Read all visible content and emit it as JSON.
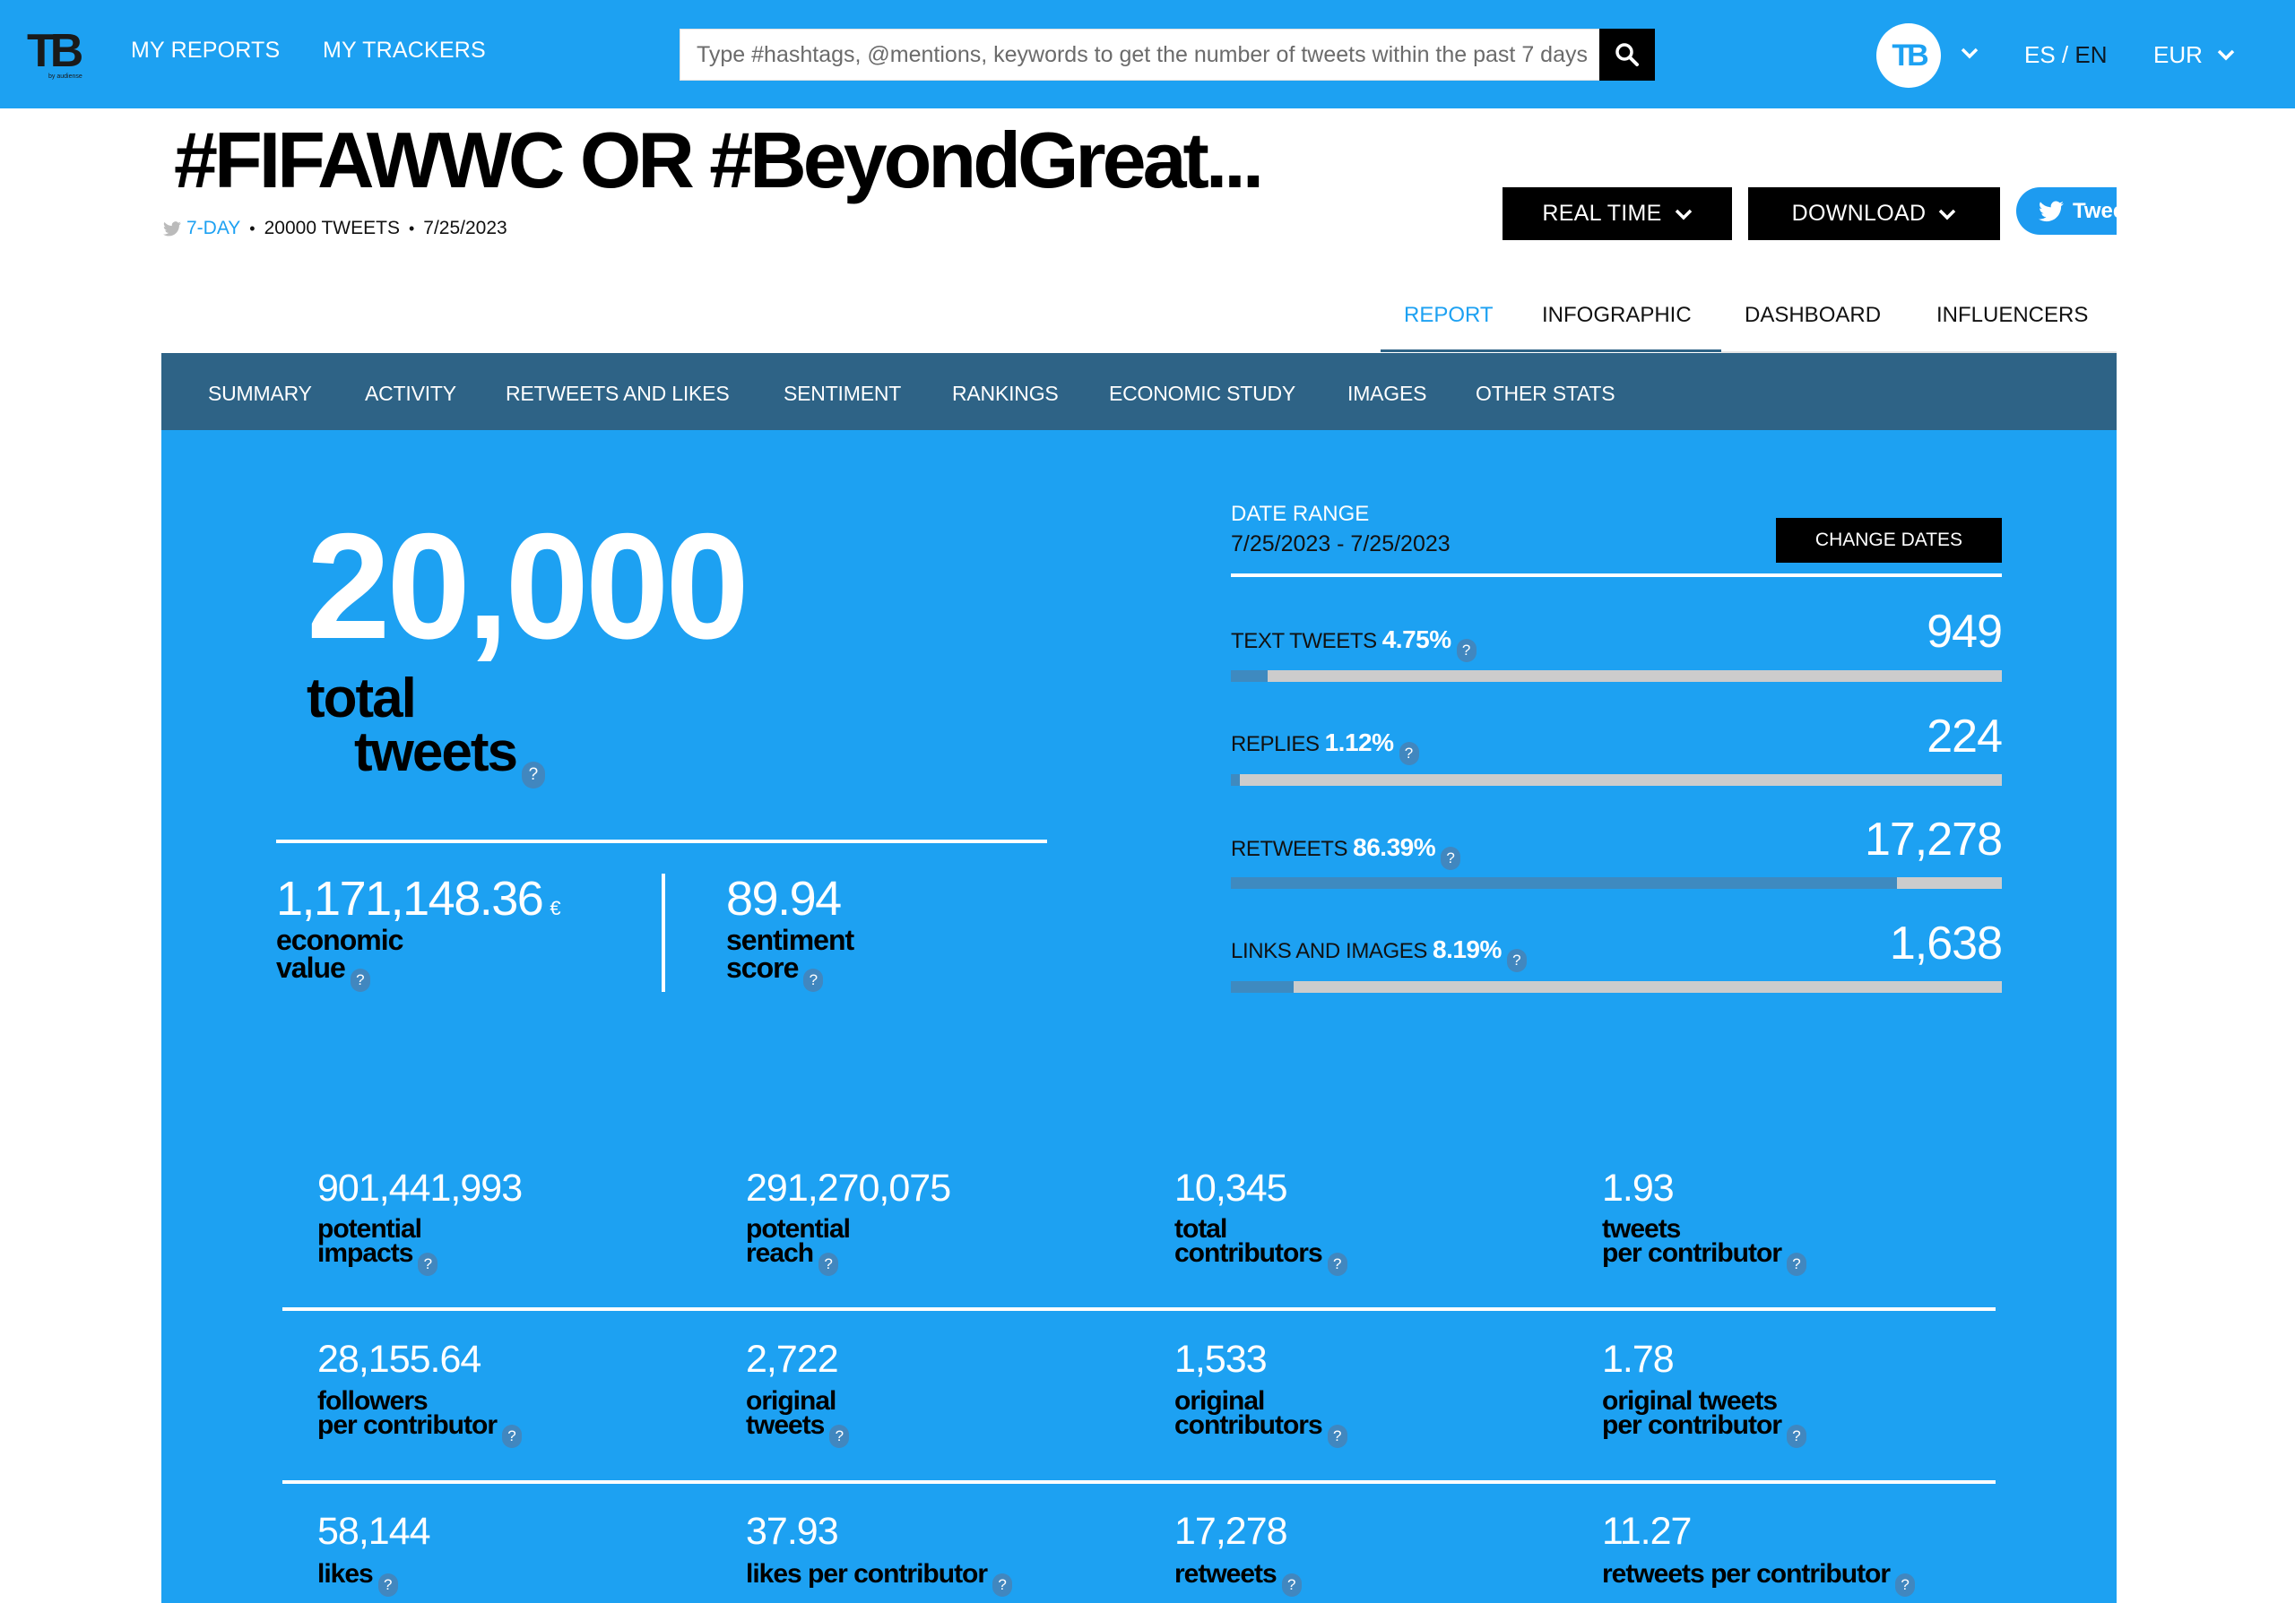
{
  "header": {
    "logo_text": "TB",
    "logo_sub": "by audiense",
    "nav": [
      "MY REPORTS",
      "MY TRACKERS"
    ],
    "search": {
      "placeholder": "Type #hashtags, @mentions, keywords to get the number of tweets within the past 7 days",
      "value": ""
    },
    "avatar_text": "TB",
    "lang": {
      "es": "ES",
      "separator": " / ",
      "en": "EN",
      "active": "EN"
    },
    "currency": "EUR"
  },
  "report": {
    "title": "#FIFAWWC OR #BeyondGreat...",
    "period": "7-DAY",
    "tweet_count_label": "20000 TWEETS",
    "date": "7/25/2023",
    "buttons": {
      "real_time": "REAL TIME",
      "download": "DOWNLOAD",
      "tweet": "Tweet"
    }
  },
  "report_tabs": [
    {
      "label": "REPORT",
      "active": true
    },
    {
      "label": "INFOGRAPHIC",
      "active": false
    },
    {
      "label": "DASHBOARD",
      "active": false
    },
    {
      "label": "INFLUENCERS",
      "active": false
    }
  ],
  "section_nav": [
    "SUMMARY",
    "ACTIVITY",
    "RETWEETS AND LIKES",
    "SENTIMENT",
    "RANKINGS",
    "ECONOMIC STUDY",
    "IMAGES",
    "OTHER STATS"
  ],
  "summary": {
    "total_tweets": "20,000",
    "total_label_1": "total",
    "total_label_2": "tweets",
    "economic_value": "1,171,148.36",
    "economic_currency": "€",
    "economic_label_1": "economic",
    "economic_label_2": "value",
    "sentiment_score": "89.94",
    "sentiment_label_1": "sentiment",
    "sentiment_label_2": "score",
    "help_glyph": "?"
  },
  "date_range": {
    "label": "DATE RANGE",
    "value": "7/25/2023 - 7/25/2023",
    "change_button": "CHANGE DATES"
  },
  "breakdown": [
    {
      "label": "TEXT TWEETS",
      "percent": "4.75%",
      "fraction": 0.0475,
      "count": "949"
    },
    {
      "label": "REPLIES",
      "percent": "1.12%",
      "fraction": 0.0112,
      "count": "224"
    },
    {
      "label": "RETWEETS",
      "percent": "86.39%",
      "fraction": 0.8639,
      "count": "17,278"
    },
    {
      "label": "LINKS AND IMAGES",
      "percent": "8.19%",
      "fraction": 0.0819,
      "count": "1,638"
    }
  ],
  "stats_grid": [
    [
      {
        "value": "901,441,993",
        "label_1": "potential",
        "label_2": "impacts"
      },
      {
        "value": "291,270,075",
        "label_1": "potential",
        "label_2": "reach"
      },
      {
        "value": "10,345",
        "label_1": "total",
        "label_2": "contributors"
      },
      {
        "value": "1.93",
        "label_1": "tweets",
        "label_2": "per contributor"
      }
    ],
    [
      {
        "value": "28,155.64",
        "label_1": "followers",
        "label_2": "per contributor"
      },
      {
        "value": "2,722",
        "label_1": "original",
        "label_2": "tweets"
      },
      {
        "value": "1,533",
        "label_1": "original",
        "label_2": "contributors"
      },
      {
        "value": "1.78",
        "label_1": "original tweets",
        "label_2": "per contributor"
      }
    ],
    [
      {
        "value": "58,144",
        "label_1": "likes",
        "label_2": ""
      },
      {
        "value": "37.93",
        "label_1": "likes per contributor",
        "label_2": ""
      },
      {
        "value": "17,278",
        "label_1": "retweets",
        "label_2": ""
      },
      {
        "value": "11.27",
        "label_1": "retweets per contributor",
        "label_2": ""
      }
    ]
  ],
  "colors": {
    "brand_blue": "#1da1f2",
    "nav_dark_blue": "#2e6386",
    "bar_fill": "#3e8ac0",
    "bar_track": "#cccccc",
    "help_badge": "#4187bf"
  }
}
